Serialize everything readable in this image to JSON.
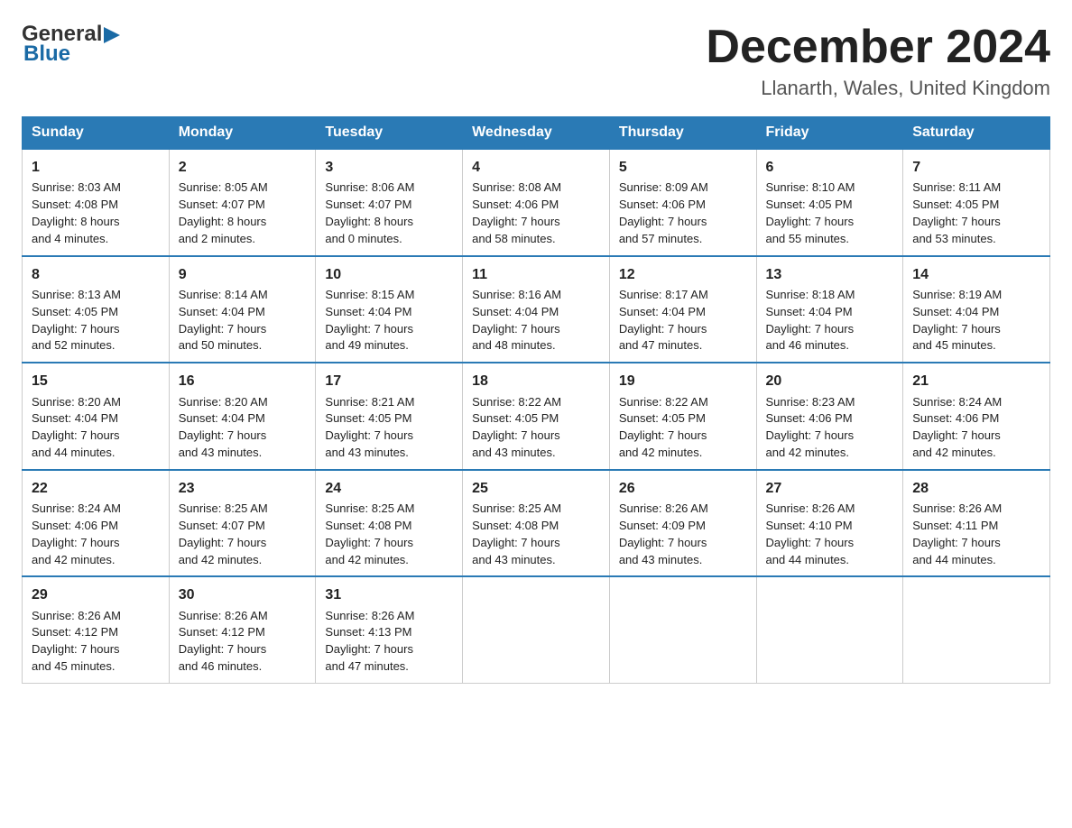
{
  "header": {
    "logo": {
      "general": "General",
      "blue": "Blue",
      "triangle": "▶"
    },
    "title": "December 2024",
    "location": "Llanarth, Wales, United Kingdom"
  },
  "weekdays": [
    "Sunday",
    "Monday",
    "Tuesday",
    "Wednesday",
    "Thursday",
    "Friday",
    "Saturday"
  ],
  "weeks": [
    [
      {
        "day": "1",
        "info": "Sunrise: 8:03 AM\nSunset: 4:08 PM\nDaylight: 8 hours\nand 4 minutes."
      },
      {
        "day": "2",
        "info": "Sunrise: 8:05 AM\nSunset: 4:07 PM\nDaylight: 8 hours\nand 2 minutes."
      },
      {
        "day": "3",
        "info": "Sunrise: 8:06 AM\nSunset: 4:07 PM\nDaylight: 8 hours\nand 0 minutes."
      },
      {
        "day": "4",
        "info": "Sunrise: 8:08 AM\nSunset: 4:06 PM\nDaylight: 7 hours\nand 58 minutes."
      },
      {
        "day": "5",
        "info": "Sunrise: 8:09 AM\nSunset: 4:06 PM\nDaylight: 7 hours\nand 57 minutes."
      },
      {
        "day": "6",
        "info": "Sunrise: 8:10 AM\nSunset: 4:05 PM\nDaylight: 7 hours\nand 55 minutes."
      },
      {
        "day": "7",
        "info": "Sunrise: 8:11 AM\nSunset: 4:05 PM\nDaylight: 7 hours\nand 53 minutes."
      }
    ],
    [
      {
        "day": "8",
        "info": "Sunrise: 8:13 AM\nSunset: 4:05 PM\nDaylight: 7 hours\nand 52 minutes."
      },
      {
        "day": "9",
        "info": "Sunrise: 8:14 AM\nSunset: 4:04 PM\nDaylight: 7 hours\nand 50 minutes."
      },
      {
        "day": "10",
        "info": "Sunrise: 8:15 AM\nSunset: 4:04 PM\nDaylight: 7 hours\nand 49 minutes."
      },
      {
        "day": "11",
        "info": "Sunrise: 8:16 AM\nSunset: 4:04 PM\nDaylight: 7 hours\nand 48 minutes."
      },
      {
        "day": "12",
        "info": "Sunrise: 8:17 AM\nSunset: 4:04 PM\nDaylight: 7 hours\nand 47 minutes."
      },
      {
        "day": "13",
        "info": "Sunrise: 8:18 AM\nSunset: 4:04 PM\nDaylight: 7 hours\nand 46 minutes."
      },
      {
        "day": "14",
        "info": "Sunrise: 8:19 AM\nSunset: 4:04 PM\nDaylight: 7 hours\nand 45 minutes."
      }
    ],
    [
      {
        "day": "15",
        "info": "Sunrise: 8:20 AM\nSunset: 4:04 PM\nDaylight: 7 hours\nand 44 minutes."
      },
      {
        "day": "16",
        "info": "Sunrise: 8:20 AM\nSunset: 4:04 PM\nDaylight: 7 hours\nand 43 minutes."
      },
      {
        "day": "17",
        "info": "Sunrise: 8:21 AM\nSunset: 4:05 PM\nDaylight: 7 hours\nand 43 minutes."
      },
      {
        "day": "18",
        "info": "Sunrise: 8:22 AM\nSunset: 4:05 PM\nDaylight: 7 hours\nand 43 minutes."
      },
      {
        "day": "19",
        "info": "Sunrise: 8:22 AM\nSunset: 4:05 PM\nDaylight: 7 hours\nand 42 minutes."
      },
      {
        "day": "20",
        "info": "Sunrise: 8:23 AM\nSunset: 4:06 PM\nDaylight: 7 hours\nand 42 minutes."
      },
      {
        "day": "21",
        "info": "Sunrise: 8:24 AM\nSunset: 4:06 PM\nDaylight: 7 hours\nand 42 minutes."
      }
    ],
    [
      {
        "day": "22",
        "info": "Sunrise: 8:24 AM\nSunset: 4:06 PM\nDaylight: 7 hours\nand 42 minutes."
      },
      {
        "day": "23",
        "info": "Sunrise: 8:25 AM\nSunset: 4:07 PM\nDaylight: 7 hours\nand 42 minutes."
      },
      {
        "day": "24",
        "info": "Sunrise: 8:25 AM\nSunset: 4:08 PM\nDaylight: 7 hours\nand 42 minutes."
      },
      {
        "day": "25",
        "info": "Sunrise: 8:25 AM\nSunset: 4:08 PM\nDaylight: 7 hours\nand 43 minutes."
      },
      {
        "day": "26",
        "info": "Sunrise: 8:26 AM\nSunset: 4:09 PM\nDaylight: 7 hours\nand 43 minutes."
      },
      {
        "day": "27",
        "info": "Sunrise: 8:26 AM\nSunset: 4:10 PM\nDaylight: 7 hours\nand 44 minutes."
      },
      {
        "day": "28",
        "info": "Sunrise: 8:26 AM\nSunset: 4:11 PM\nDaylight: 7 hours\nand 44 minutes."
      }
    ],
    [
      {
        "day": "29",
        "info": "Sunrise: 8:26 AM\nSunset: 4:12 PM\nDaylight: 7 hours\nand 45 minutes."
      },
      {
        "day": "30",
        "info": "Sunrise: 8:26 AM\nSunset: 4:12 PM\nDaylight: 7 hours\nand 46 minutes."
      },
      {
        "day": "31",
        "info": "Sunrise: 8:26 AM\nSunset: 4:13 PM\nDaylight: 7 hours\nand 47 minutes."
      },
      null,
      null,
      null,
      null
    ]
  ]
}
